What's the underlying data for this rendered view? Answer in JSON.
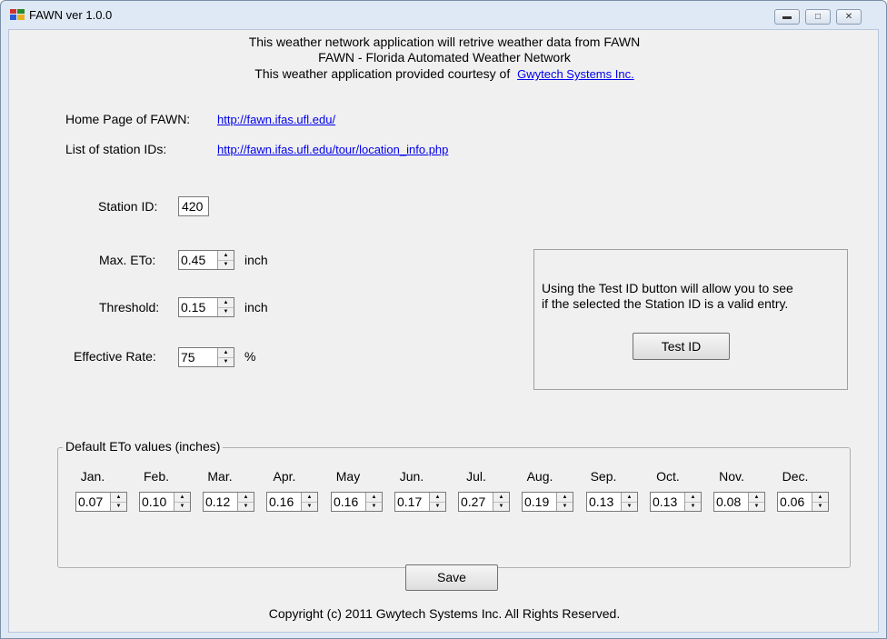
{
  "window": {
    "title": "FAWN ver 1.0.0",
    "icon": "app-window-icon",
    "buttons": [
      "minimize",
      "maximize",
      "close"
    ]
  },
  "header": {
    "line1": "This weather network application will retrive weather data from FAWN",
    "line2": "FAWN - Florida Automated Weather Network",
    "line3": "This weather application provided courtesy of",
    "courtesy_link": "Gwytech Systems Inc."
  },
  "links": {
    "home_label": "Home Page of FAWN:",
    "home_url": "http://fawn.ifas.ufl.edu/",
    "stations_label": "List of station IDs:",
    "stations_url": "http://fawn.ifas.ufl.edu/tour/location_info.php"
  },
  "form": {
    "station_id_label": "Station ID:",
    "station_id_value": "420",
    "max_eto_label": "Max. ETo:",
    "max_eto_value": "0.45",
    "max_eto_unit": "inch",
    "threshold_label": "Threshold:",
    "threshold_value": "0.15",
    "threshold_unit": "inch",
    "effective_rate_label": "Effective Rate:",
    "effective_rate_value": "75",
    "effective_rate_unit": "%"
  },
  "test_panel": {
    "text_line1": "Using the Test ID button will allow you to see",
    "text_line2": "if the selected the Station ID is a valid entry.",
    "button_label": "Test ID"
  },
  "defaults": {
    "legend": "Default ETo values (inches)",
    "months": [
      {
        "name": "Jan.",
        "value": "0.07"
      },
      {
        "name": "Feb.",
        "value": "0.10"
      },
      {
        "name": "Mar.",
        "value": "0.12"
      },
      {
        "name": "Apr.",
        "value": "0.16"
      },
      {
        "name": "May",
        "value": "0.16"
      },
      {
        "name": "Jun.",
        "value": "0.17"
      },
      {
        "name": "Jul.",
        "value": "0.27"
      },
      {
        "name": "Aug.",
        "value": "0.19"
      },
      {
        "name": "Sep.",
        "value": "0.13"
      },
      {
        "name": "Oct.",
        "value": "0.13"
      },
      {
        "name": "Nov.",
        "value": "0.08"
      },
      {
        "name": "Dec.",
        "value": "0.06"
      }
    ]
  },
  "save_label": "Save",
  "copyright": "Copyright (c) 2011  Gwytech Systems Inc. All Rights Reserved."
}
